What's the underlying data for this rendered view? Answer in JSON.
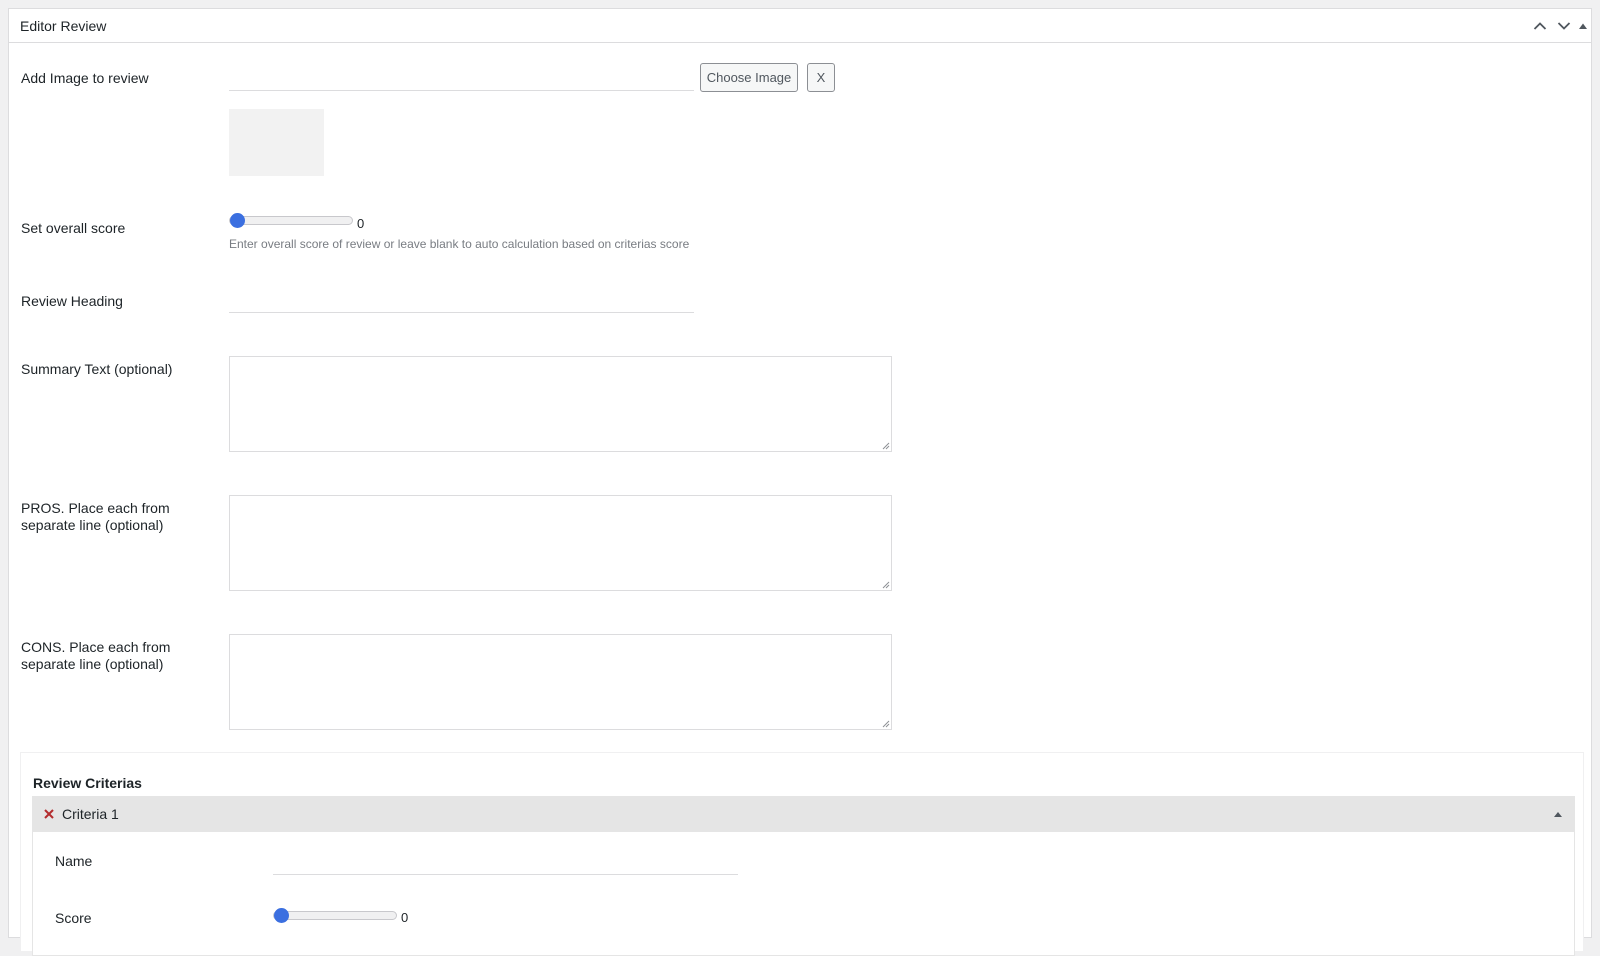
{
  "metabox": {
    "title": "Editor Review",
    "header_icons": [
      "chevron-up-icon",
      "chevron-down-icon",
      "triangle-up-icon"
    ]
  },
  "image_field": {
    "label": "Add Image to review",
    "value": "",
    "choose_label": "Choose Image",
    "clear_label": "X"
  },
  "overall_score": {
    "label": "Set overall score",
    "value": "0",
    "level": 0,
    "help": "Enter overall score of review or leave blank to auto calculation based on criterias score"
  },
  "heading_field": {
    "label": "Review Heading",
    "value": ""
  },
  "summary_field": {
    "label": "Summary Text (optional)",
    "value": ""
  },
  "pros_field": {
    "label_line1": "PROS. Place each from",
    "label_line2": "separate line (optional)",
    "value": ""
  },
  "cons_field": {
    "label_line1": "CONS. Place each from",
    "label_line2": "separate line (optional)",
    "value": ""
  },
  "criterias": {
    "title": "Review Criterias",
    "items": [
      {
        "header": "Criteria 1",
        "name_label": "Name",
        "name_value": "",
        "score_label": "Score",
        "score_value": "0",
        "score_level": 0
      }
    ]
  },
  "colors": {
    "accent": "#3b6fe0",
    "remove": "#b32d2e",
    "border": "#dcdcde",
    "criteria_header_bg": "#e5e5e5"
  }
}
